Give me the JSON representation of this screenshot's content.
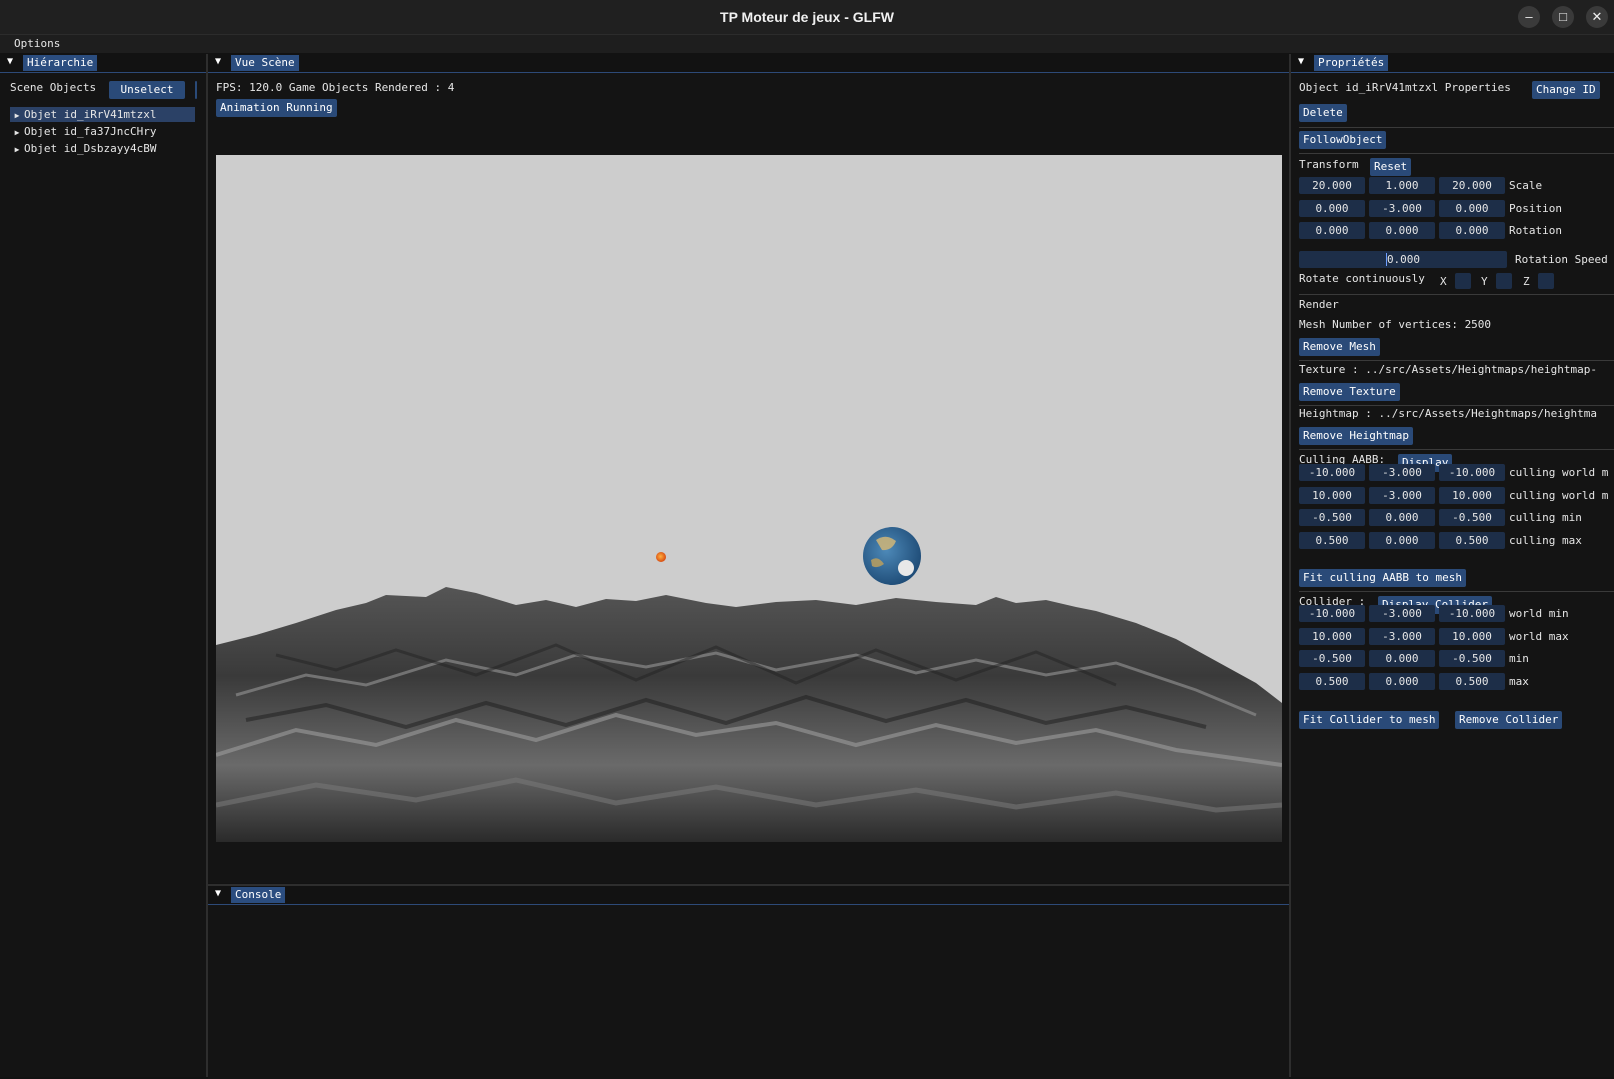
{
  "window": {
    "title": "TP Moteur de jeux - GLFW",
    "minimize": "–",
    "maximize": "□",
    "close": "✕"
  },
  "menu": {
    "options": "Options"
  },
  "hierarchy": {
    "title": "Hiérarchie",
    "scene_label": "Scene Objects",
    "unselect": "Unselect",
    "items": [
      {
        "label": "Objet id_iRrV41mtzxl",
        "selected": true
      },
      {
        "label": "Objet id_fa37JncCHry",
        "selected": false
      },
      {
        "label": "Objet id_Dsbzayy4cBW",
        "selected": false
      }
    ]
  },
  "scene": {
    "title": "Vue Scène",
    "stats": "FPS: 120.0 Game Objects Rendered : 4",
    "animation_btn": "Animation Running",
    "sky_color": "#cdcdcd"
  },
  "console": {
    "title": "Console"
  },
  "props": {
    "title": "Propriétés",
    "object_line": "Object id_iRrV41mtzxl Properties",
    "change_id": "Change ID",
    "delete": "Delete",
    "follow": "FollowObject",
    "transform_label": "Transform",
    "reset": "Reset",
    "rows": [
      {
        "v": [
          "20.000",
          "1.000",
          "20.000"
        ],
        "label": "Scale"
      },
      {
        "v": [
          "0.000",
          "-3.000",
          "0.000"
        ],
        "label": "Position"
      },
      {
        "v": [
          "0.000",
          "0.000",
          "0.000"
        ],
        "label": "Rotation"
      }
    ],
    "rotation_speed": {
      "value": "0.000",
      "label": "Rotation Speed"
    },
    "rotate_label": "Rotate continuously",
    "axis_x": "X",
    "axis_y": "Y",
    "axis_z": "Z",
    "render_label": "Render",
    "mesh_vertices": "Mesh Number of vertices: 2500",
    "remove_mesh": "Remove Mesh",
    "texture": "Texture : ../src/Assets/Heightmaps/heightmap-",
    "remove_texture": "Remove Texture",
    "heightmap": "Heightmap : ../src/Assets/Heightmaps/heightma",
    "remove_heightmap": "Remove Heightmap",
    "culling_label": "Culling AABB:",
    "display": "Display",
    "culling_rows": [
      {
        "v": [
          "-10.000",
          "-3.000",
          "-10.000"
        ],
        "label": "culling world m"
      },
      {
        "v": [
          "10.000",
          "-3.000",
          "10.000"
        ],
        "label": "culling world m"
      },
      {
        "v": [
          "-0.500",
          "0.000",
          "-0.500"
        ],
        "label": "culling min"
      },
      {
        "v": [
          "0.500",
          "0.000",
          "0.500"
        ],
        "label": "culling max"
      }
    ],
    "fit_culling": "Fit culling AABB to mesh",
    "collider_label": "Collider :",
    "display_collider": "Display Collider",
    "collider_rows": [
      {
        "v": [
          "-10.000",
          "-3.000",
          "-10.000"
        ],
        "label": "world min"
      },
      {
        "v": [
          "10.000",
          "-3.000",
          "10.000"
        ],
        "label": "world max"
      },
      {
        "v": [
          "-0.500",
          "0.000",
          "-0.500"
        ],
        "label": "min"
      },
      {
        "v": [
          "0.500",
          "0.000",
          "0.500"
        ],
        "label": "max"
      }
    ],
    "fit_collider": "Fit Collider to mesh",
    "remove_collider": "Remove Collider"
  }
}
